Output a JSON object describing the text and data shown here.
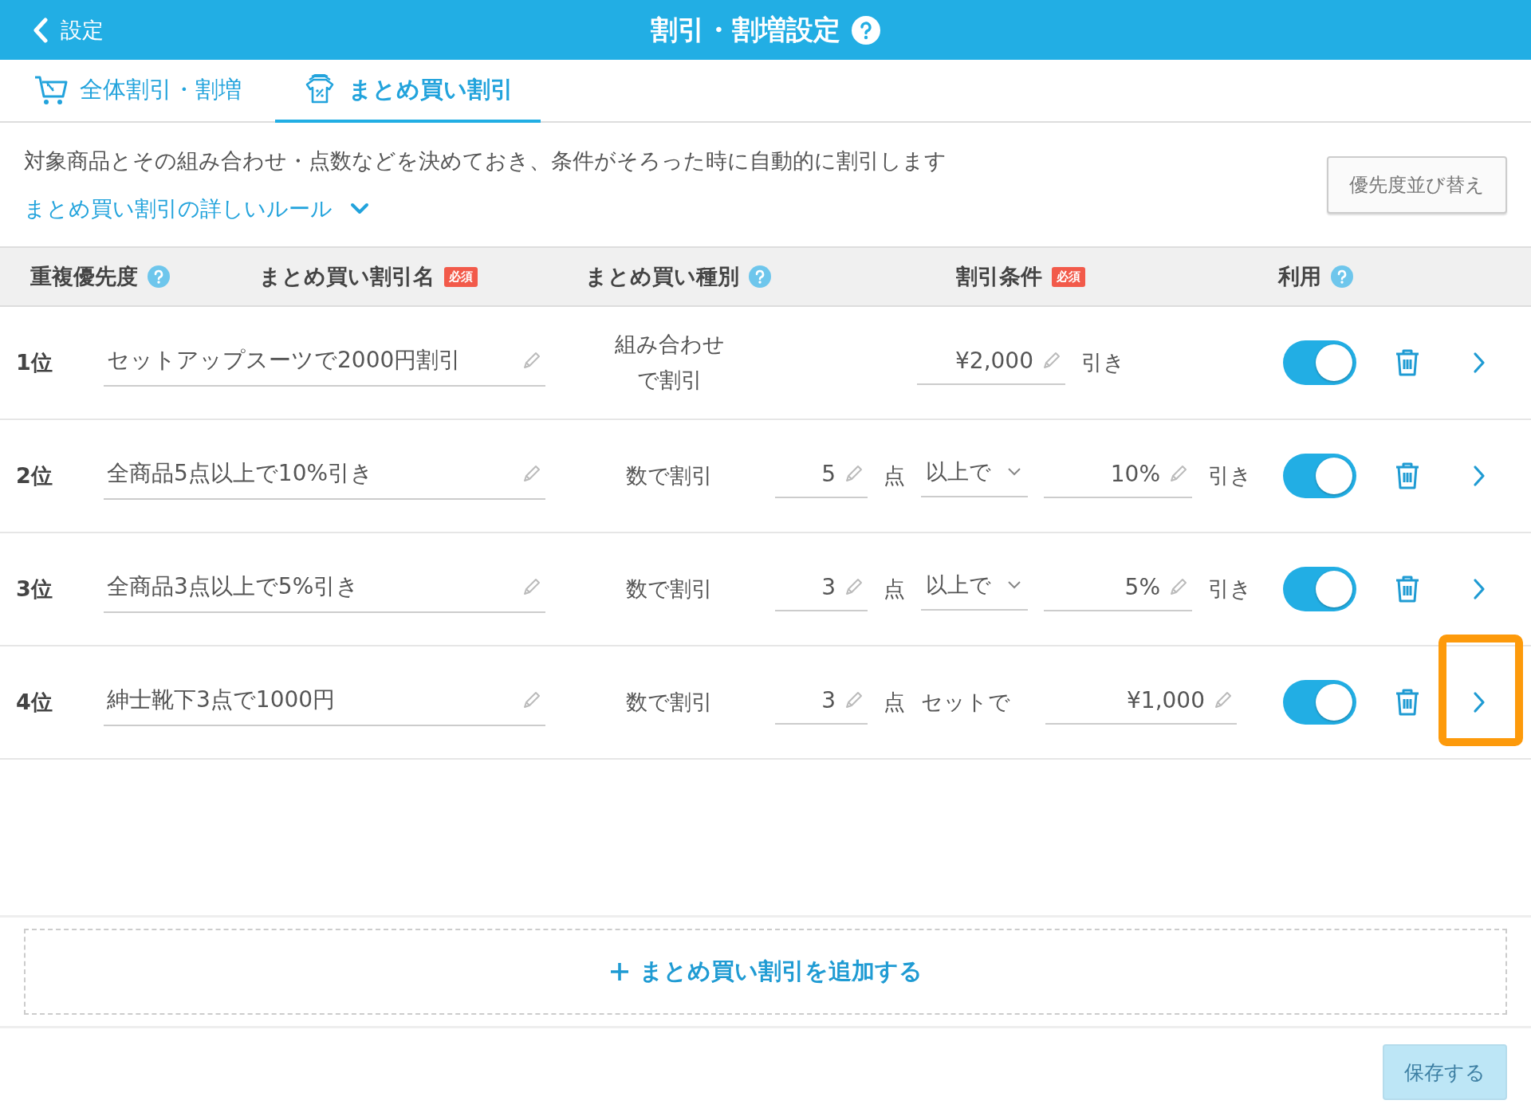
{
  "header": {
    "back": "設定",
    "title": "割引・割増設定"
  },
  "tabs": [
    {
      "label": "全体割引・割増",
      "selected": false
    },
    {
      "label": "まとめ買い割引",
      "selected": true
    }
  ],
  "intro": {
    "description": "対象商品とその組み合わせ・点数などを決めておき、条件がそろった時に自動的に割引します",
    "rules_link": "まとめ買い割引の詳しいルール",
    "sort_button": "優先度並び替え"
  },
  "table": {
    "columns": [
      {
        "label": "重複優先度",
        "help": true,
        "required": false
      },
      {
        "label": "まとめ買い割引名",
        "help": false,
        "required": true,
        "badge": "必須"
      },
      {
        "label": "まとめ買い種別",
        "help": true,
        "required": false
      },
      {
        "label": "割引条件",
        "help": false,
        "required": true,
        "badge": "必須"
      },
      {
        "label": "利用",
        "help": true,
        "required": false
      }
    ],
    "rows": [
      {
        "rank": "1位",
        "name": "セットアップスーツで2000円割引",
        "type": "組み合わせで割引",
        "condition": {
          "kind": "amount",
          "value": "¥2,000",
          "suffix": "引き"
        },
        "enabled": true,
        "highlighted": false
      },
      {
        "rank": "2位",
        "name": "全商品5点以上で10%引き",
        "type": "数で割引",
        "condition": {
          "kind": "quantity",
          "count": "5",
          "unit": "点",
          "operator": "以上で",
          "value": "10%",
          "suffix": "引き"
        },
        "enabled": true,
        "highlighted": false
      },
      {
        "rank": "3位",
        "name": "全商品3点以上で5%引き",
        "type": "数で割引",
        "condition": {
          "kind": "quantity",
          "count": "3",
          "unit": "点",
          "operator": "以上で",
          "value": "5%",
          "suffix": "引き"
        },
        "enabled": true,
        "highlighted": false
      },
      {
        "rank": "4位",
        "name": "紳士靴下3点で1000円",
        "type": "数で割引",
        "condition": {
          "kind": "set",
          "count": "3",
          "unit": "点",
          "operator": "セットで",
          "value": "¥1,000"
        },
        "enabled": true,
        "highlighted": true
      }
    ]
  },
  "add_button": "まとめ買い割引を追加する",
  "save_button": {
    "label": "保存する",
    "disabled": true
  }
}
